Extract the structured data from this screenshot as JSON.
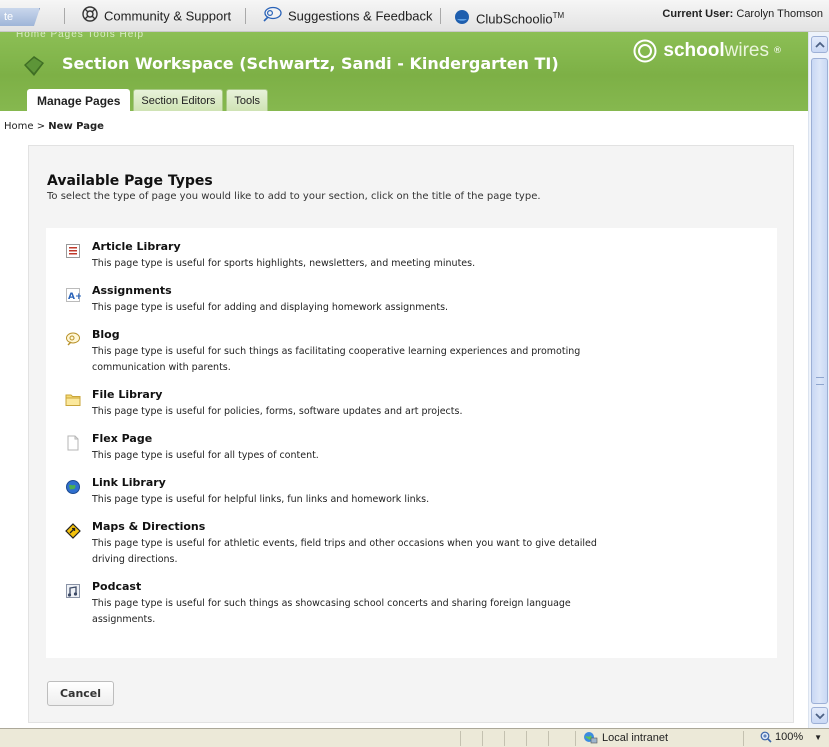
{
  "toolbar": {
    "corner_label": "te",
    "community_label": "Community & Support",
    "suggestions_label": "Suggestions & Feedback",
    "club_label": "ClubSchoolio",
    "club_tm": "TM",
    "current_user_label": "Current User:",
    "current_user_name": "Carolyn Thomson"
  },
  "header": {
    "menu_ghost": "Home   Pages   Tools   Help",
    "title": "Section Workspace (Schwartz, Sandi - Kindergarten TI)",
    "brand_bold": "school",
    "brand_light": "wires",
    "brand_reg": "®",
    "tabs": [
      {
        "label": "Manage Pages",
        "active": true
      },
      {
        "label": "Section Editors",
        "active": false
      },
      {
        "label": "Tools",
        "active": false
      }
    ]
  },
  "breadcrumb": {
    "home": "Home",
    "sep": ">",
    "current": "New Page"
  },
  "panel": {
    "title": "Available Page Types",
    "subtitle": "To select the type of page you would like to add to your section, click on the title of the page type.",
    "cancel_label": "Cancel"
  },
  "page_types": [
    {
      "name": "Article Library",
      "icon": "article-library-icon",
      "desc": "This page type is useful for sports highlights, newsletters, and meeting minutes."
    },
    {
      "name": "Assignments",
      "icon": "assignments-icon",
      "desc": "This page type is useful for adding and displaying homework assignments."
    },
    {
      "name": "Blog",
      "icon": "blog-icon",
      "desc": "This page type is useful for such things as facilitating cooperative learning experiences and promoting communication with parents."
    },
    {
      "name": "File Library",
      "icon": "file-library-icon",
      "desc": "This page type is useful for policies, forms, software updates and art projects."
    },
    {
      "name": "Flex Page",
      "icon": "flex-page-icon",
      "desc": "This page type is useful for all types of content."
    },
    {
      "name": "Link Library",
      "icon": "link-library-icon",
      "desc": "This page type is useful for helpful links, fun links and homework links."
    },
    {
      "name": "Maps & Directions",
      "icon": "maps-directions-icon",
      "desc": "This page type is useful for athletic events, field trips and other occasions when you want to give detailed driving directions."
    },
    {
      "name": "Podcast",
      "icon": "podcast-icon",
      "desc": "This page type is useful for such things as showcasing school concerts and sharing foreign language assignments."
    }
  ],
  "statusbar": {
    "zone": "Local intranet",
    "zoom": "100%"
  },
  "colors": {
    "header_green": "#7db046",
    "panel_bg": "#f4f4f4",
    "accent_blue": "#2a63b8"
  }
}
